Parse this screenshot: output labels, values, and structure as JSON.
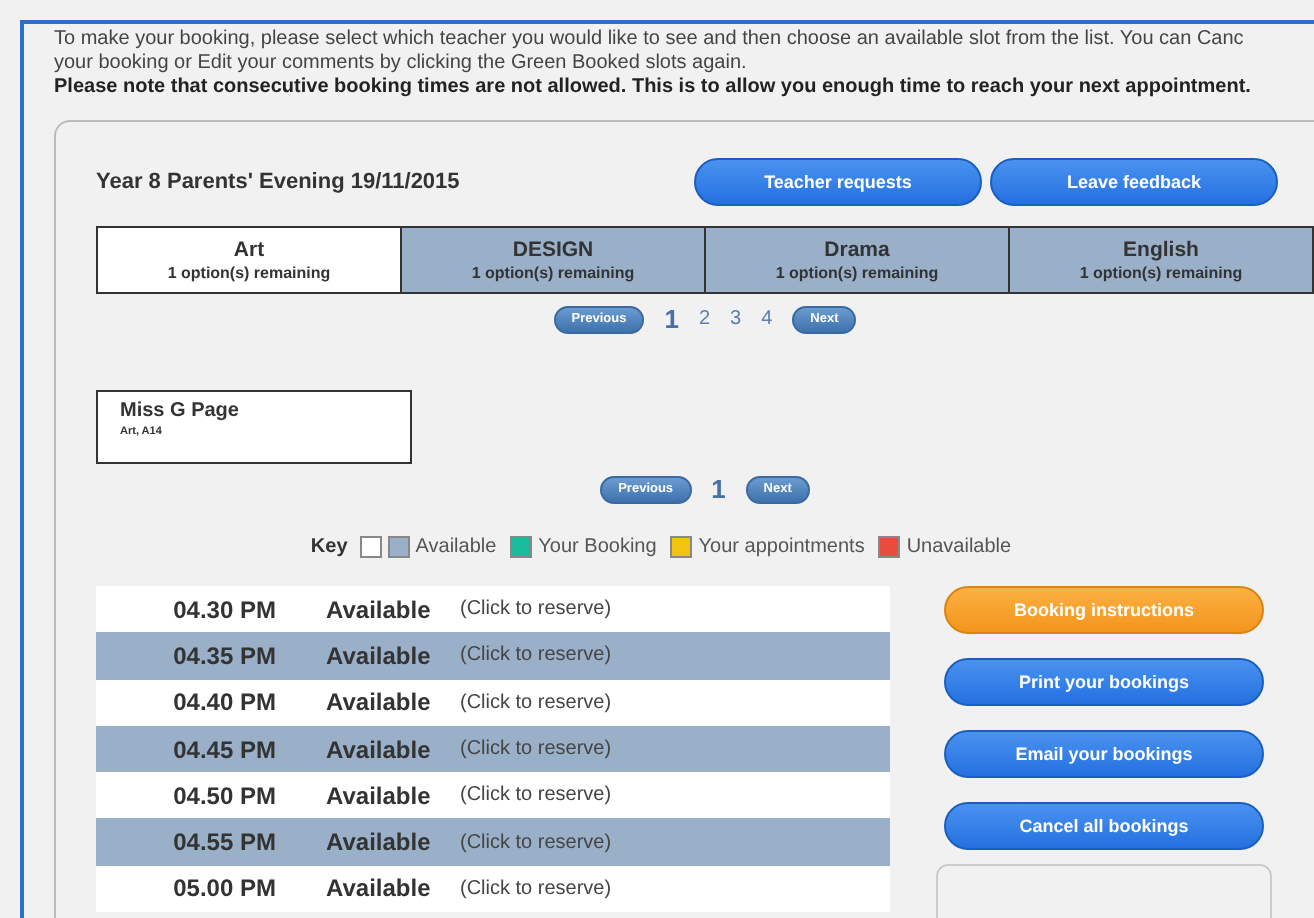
{
  "intro": {
    "lines": [
      "To make your booking, please select which teacher you would like to see and then choose an available slot from the list. You can Canc",
      "your booking or Edit your comments by clicking the Green Booked slots again."
    ],
    "note": "Please note that consecutive booking times are not allowed. This is to allow you enough time to reach your next appointment."
  },
  "event": {
    "title": "Year 8 Parents' Evening 19/11/2015",
    "buttons": [
      "Teacher requests",
      "Leave feedback"
    ]
  },
  "subjects": [
    {
      "name": "Art",
      "remaining": "1 option(s) remaining",
      "selected": true
    },
    {
      "name": "DESIGN",
      "remaining": "1 option(s) remaining",
      "selected": false
    },
    {
      "name": "Drama",
      "remaining": "1 option(s) remaining",
      "selected": false
    },
    {
      "name": "English",
      "remaining": "1 option(s) remaining",
      "selected": false
    }
  ],
  "subject_pager": {
    "previous": "Previous",
    "next": "Next",
    "pages": [
      {
        "label": "1",
        "selected": true
      },
      {
        "label": "2",
        "selected": false
      },
      {
        "label": "3",
        "selected": false
      },
      {
        "label": "4",
        "selected": false
      }
    ]
  },
  "teacher": {
    "name": "Miss G Page",
    "detail": "Art, A14"
  },
  "teacher_pager": {
    "previous": "Previous",
    "next": "Next",
    "pages": [
      {
        "label": "1",
        "selected": true
      }
    ]
  },
  "key": {
    "label": "Key",
    "items": [
      {
        "color": "#ffffff"
      },
      {
        "label": "Available",
        "color": "#9ab0c9"
      },
      {
        "label": "Your Booking",
        "color": "#1abc9c"
      },
      {
        "label": "Your appointments",
        "color": "#f1c40f"
      },
      {
        "label": "Unavailable",
        "color": "#e74c3c"
      }
    ]
  },
  "slots": [
    {
      "time": "04.30 PM",
      "status": "Available",
      "action": "(Click to reserve)"
    },
    {
      "time": "04.35 PM",
      "status": "Available",
      "action": "(Click to reserve)"
    },
    {
      "time": "04.40 PM",
      "status": "Available",
      "action": "(Click to reserve)"
    },
    {
      "time": "04.45 PM",
      "status": "Available",
      "action": "(Click to reserve)"
    },
    {
      "time": "04.50 PM",
      "status": "Available",
      "action": "(Click to reserve)"
    },
    {
      "time": "04.55 PM",
      "status": "Available",
      "action": "(Click to reserve)"
    },
    {
      "time": "05.00 PM",
      "status": "Available",
      "action": "(Click to reserve)"
    }
  ],
  "actions": [
    {
      "label": "Booking instructions",
      "kind": "orange"
    },
    {
      "label": "Print your bookings",
      "kind": "blue"
    },
    {
      "label": "Email your bookings",
      "kind": "blue"
    },
    {
      "label": "Cancel all bookings",
      "kind": "blue"
    }
  ]
}
